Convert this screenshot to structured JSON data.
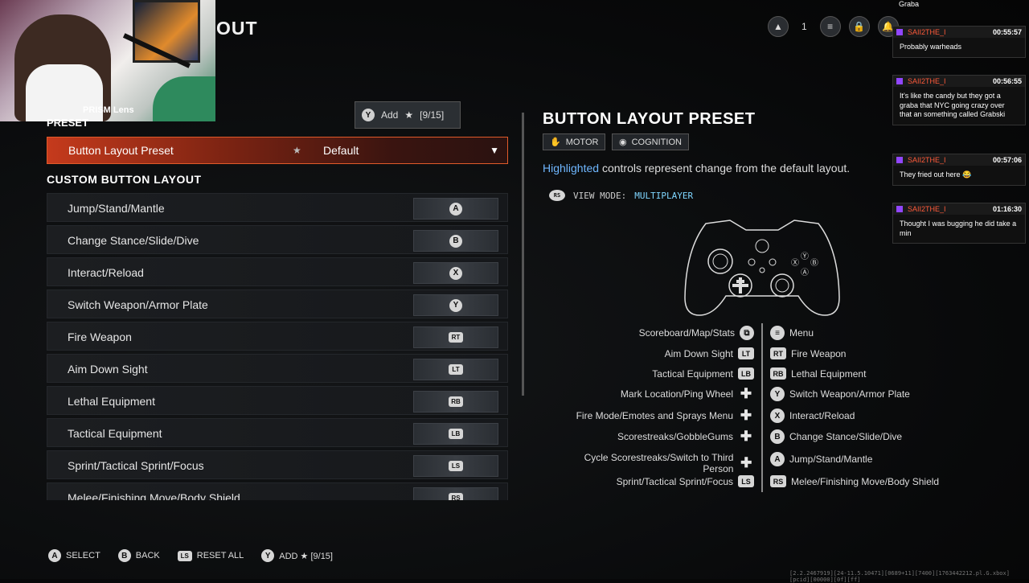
{
  "header": {
    "title_partial": "OUT",
    "party_count": "1"
  },
  "webcam": {
    "watermark": "PRISM Lens"
  },
  "tooltip": {
    "button": "Y",
    "label": "Add",
    "count": "[9/15]"
  },
  "preset_section": {
    "title": "PRESET",
    "row_label": "Button Layout Preset",
    "value": "Default"
  },
  "custom_section": {
    "title": "CUSTOM BUTTON LAYOUT",
    "rows": [
      {
        "label": "Jump/Stand/Mantle",
        "glyph": "A",
        "shape": "round"
      },
      {
        "label": "Change Stance/Slide/Dive",
        "glyph": "B",
        "shape": "round"
      },
      {
        "label": "Interact/Reload",
        "glyph": "X",
        "shape": "round"
      },
      {
        "label": "Switch Weapon/Armor Plate",
        "glyph": "Y",
        "shape": "round"
      },
      {
        "label": "Fire Weapon",
        "glyph": "RT",
        "shape": "square"
      },
      {
        "label": "Aim Down Sight",
        "glyph": "LT",
        "shape": "square"
      },
      {
        "label": "Lethal Equipment",
        "glyph": "RB",
        "shape": "square"
      },
      {
        "label": "Tactical Equipment",
        "glyph": "LB",
        "shape": "square"
      },
      {
        "label": "Sprint/Tactical Sprint/Focus",
        "glyph": "LS",
        "shape": "stick"
      },
      {
        "label": "Melee/Finishing Move/Body Shield",
        "glyph": "RS",
        "shape": "stick"
      }
    ]
  },
  "right_panel": {
    "title": "BUTTON LAYOUT PRESET",
    "tags": [
      "MOTOR",
      "COGNITION"
    ],
    "desc_highlight": "Highlighted",
    "desc_rest": " controls represent change from the default layout.",
    "view_mode_label": "VIEW MODE:",
    "view_mode_value": "MULTIPLAYER",
    "left_mappings": [
      {
        "label": "Scoreboard/Map/Stats",
        "glyph": "⧉",
        "kind": "round"
      },
      {
        "label": "Aim Down Sight",
        "glyph": "LT",
        "kind": "sq"
      },
      {
        "label": "Tactical Equipment",
        "glyph": "LB",
        "kind": "sq"
      },
      {
        "label": "Mark Location/Ping Wheel",
        "glyph": "✚",
        "kind": "dpad"
      },
      {
        "label": "Fire Mode/Emotes and Sprays Menu",
        "glyph": "✚",
        "kind": "dpad"
      },
      {
        "label": "Scorestreaks/GobbleGums",
        "glyph": "✚",
        "kind": "dpad"
      },
      {
        "label": "Cycle Scorestreaks/Switch to Third Person",
        "glyph": "✚",
        "kind": "dpad"
      },
      {
        "label": "Sprint/Tactical Sprint/Focus",
        "glyph": "LS",
        "kind": "sq"
      }
    ],
    "right_mappings": [
      {
        "label": "Menu",
        "glyph": "≡",
        "kind": "round"
      },
      {
        "label": "Fire Weapon",
        "glyph": "RT",
        "kind": "sq"
      },
      {
        "label": "Lethal Equipment",
        "glyph": "RB",
        "kind": "sq"
      },
      {
        "label": "Switch Weapon/Armor Plate",
        "glyph": "Y",
        "kind": "round"
      },
      {
        "label": "Interact/Reload",
        "glyph": "X",
        "kind": "round"
      },
      {
        "label": "Change Stance/Slide/Dive",
        "glyph": "B",
        "kind": "round"
      },
      {
        "label": "Jump/Stand/Mantle",
        "glyph": "A",
        "kind": "round"
      },
      {
        "label": "Melee/Finishing Move/Body Shield",
        "glyph": "RS",
        "kind": "sq"
      }
    ]
  },
  "chat": {
    "top_line": "Graba",
    "messages": [
      {
        "user": "SAII2THE_I",
        "time": "00:55:57",
        "text": "Probably warheads"
      },
      {
        "user": "SAII2THE_I",
        "time": "00:56:55",
        "text": "It's like the candy but they got a graba that NYC going crazy over that an something called Grabski"
      },
      {
        "user": "SAII2THE_I",
        "time": "00:57:06",
        "text": "They fried out here 😂"
      },
      {
        "user": "SAII2THE_I",
        "time": "01:16:30",
        "text": "Thought I was bugging he did take a min"
      }
    ]
  },
  "footer": {
    "items": [
      {
        "glyph": "A",
        "label": "SELECT"
      },
      {
        "glyph": "B",
        "label": "BACK"
      },
      {
        "glyph": "LS",
        "label": "RESET ALL"
      },
      {
        "glyph": "Y",
        "label": "ADD ★ [9/15]"
      }
    ],
    "version": "[2.2.2467919][24-11.5.10471][0689+11][7400][1763442212.pl.G.xbox][pcid][00000][0f][ff]"
  }
}
